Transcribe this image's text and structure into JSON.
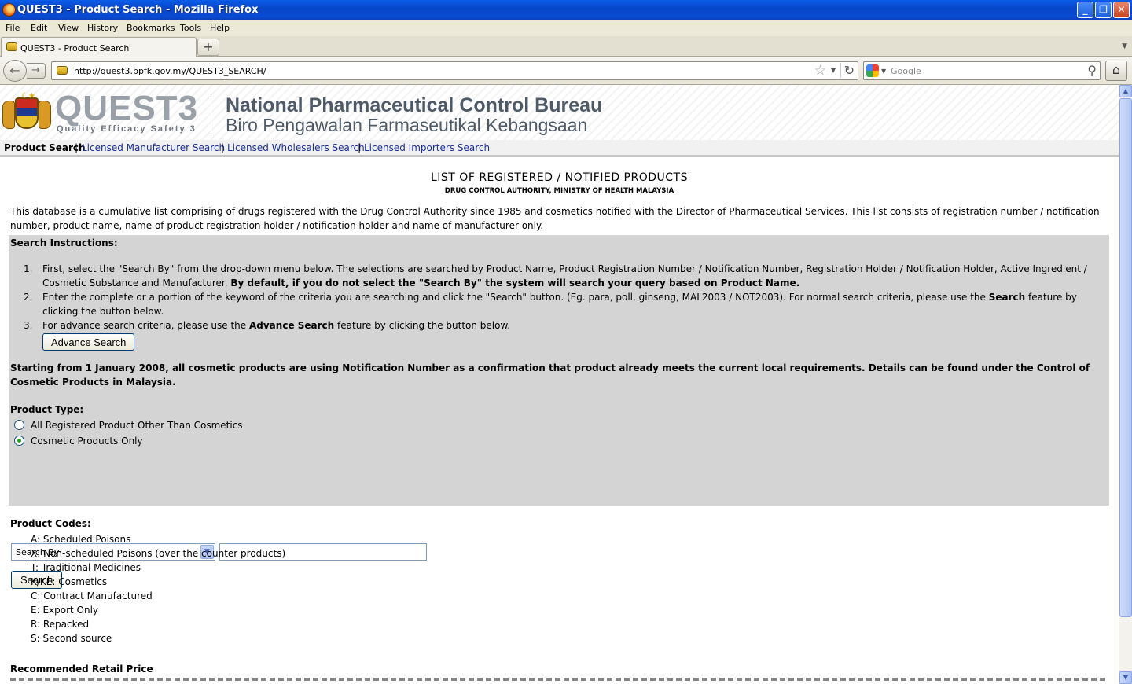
{
  "window": {
    "title": "QUEST3 - Product Search - Mozilla Firefox",
    "min_glyph": "_",
    "max_glyph": "❐",
    "close_glyph": "✕"
  },
  "menu": [
    "File",
    "Edit",
    "View",
    "History",
    "Bookmarks",
    "Tools",
    "Help"
  ],
  "tabs": [
    {
      "label": "QUEST3 - Product Search"
    }
  ],
  "new_tab_glyph": "+",
  "nav": {
    "url": "http://quest3.bpfk.gov.my/QUEST3_SEARCH/",
    "search_placeholder": "Google",
    "back_glyph": "←",
    "forward_glyph": "→",
    "reload_glyph": "↻",
    "home_glyph": "⌂"
  },
  "site": {
    "logo_text": "QUEST3",
    "logo_tagline": "Quality Efficacy Safety 3",
    "org_en": "National Pharmaceutical Control Bureau",
    "org_my": "Biro Pengawalan Farmaseutikal Kebangsaan",
    "nav": {
      "active": "Product Search",
      "links": [
        "Licensed Manufacturer Search",
        "Licensed Wholesalers Search",
        "Licensed Importers Search"
      ],
      "separator": "|"
    }
  },
  "main": {
    "heading": "LIST OF REGISTERED / NOTIFIED PRODUCTS",
    "subheading": "DRUG CONTROL AUTHORITY, MINISTRY OF HEALTH MALAYSIA",
    "intro": "This database is a cumulative list comprising of drugs registered with the Drug Control Authority since 1985 and cosmetics notified with the Director of Pharmaceutical Services. This list consists of registration number / notification number, product name, name of product registration holder / notification holder and name of manufacturer only.",
    "instructions_title": "Search Instructions:",
    "instructions": {
      "item1_a": "First, select the \"Search By\" from the drop-down menu below. The selections are searched by Product Name, Product Registration Number / Notification Number, Registration Holder / Notification Holder, Active Ingredient / Cosmetic Substance and Manufacturer.",
      "item1_b": "By default, if you do not select the \"Search By\" the system will search your query based on Product Name.",
      "item2_a": "Enter the complete or a portion of the keyword of the criteria you are searching and click the \"Search\" button. (Eg. para, poll, ginseng, MAL2003 / NOT2003). For normal search criteria, please use the",
      "item2_b": "Search",
      "item2_c": "feature by clicking the button below.",
      "item3_a": "For advance search criteria, please use the",
      "item3_b": "Advance Search",
      "item3_c": "feature by clicking the button below."
    },
    "advance_button": "Advance Search",
    "notice": "Starting from 1 January 2008, all cosmetic products are using Notification Number as a confirmation that product already meets the current local requirements. Details can be found under the Control of Cosmetic Products in Malaysia.",
    "product_type_label": "Product Type:",
    "product_types": [
      {
        "label": "All Registered Product Other Than Cosmetics",
        "checked": false
      },
      {
        "label": "Cosmetic Products Only",
        "checked": true
      }
    ],
    "search_by": "Search By",
    "keyword_value": "",
    "search_button": "Search",
    "codes_title": "Product Codes:",
    "codes": [
      "A: Scheduled Poisons",
      "X: Non-scheduled Poisons (over the counter products)",
      "T: Traditional Medicines",
      "K/KE: Cosmetics",
      "C: Contract Manufactured",
      "E: Export Only",
      "R: Repacked",
      "S: Second source"
    ],
    "retail_title": "Recommended Retail Price"
  }
}
